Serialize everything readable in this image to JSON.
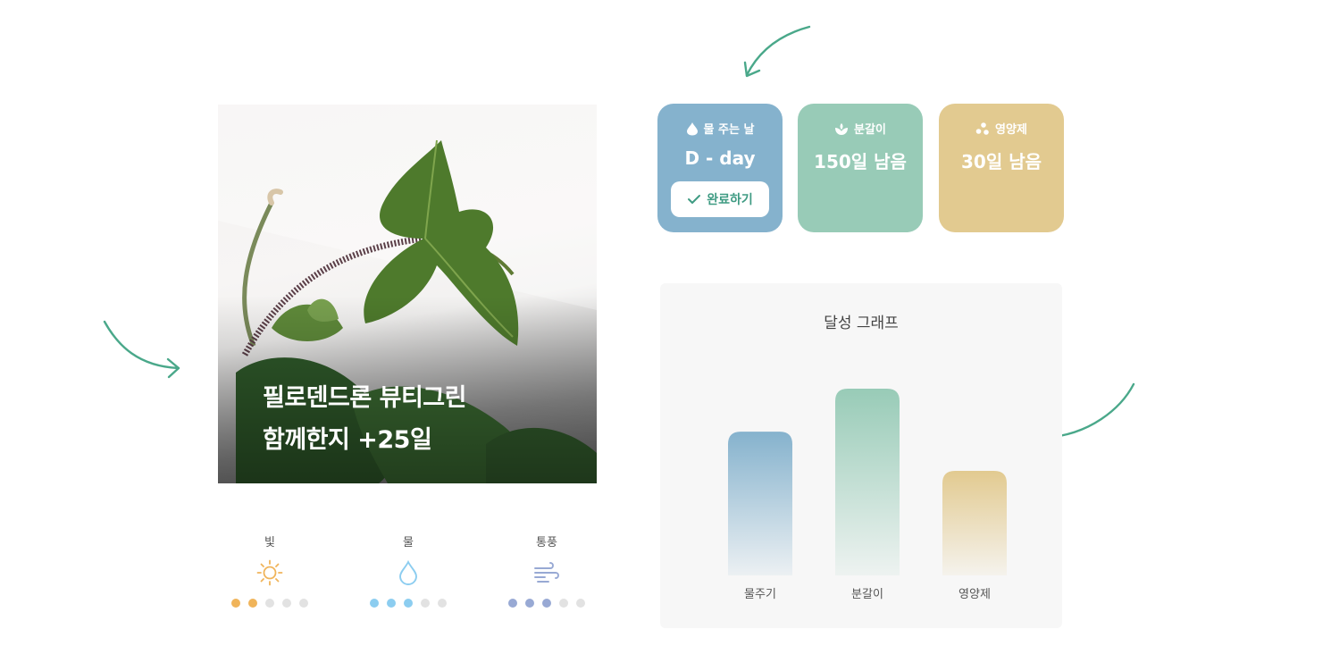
{
  "plant": {
    "name": "필로덴드론 뷰티그린",
    "together": "함께한지 +25일"
  },
  "conditions": [
    {
      "label": "빛",
      "icon": "sun-icon",
      "level": 2,
      "max": 5,
      "color": "#f0b45a"
    },
    {
      "label": "물",
      "icon": "water-drop-icon",
      "level": 3,
      "max": 5,
      "color": "#8ccdf0"
    },
    {
      "label": "통풍",
      "icon": "wind-icon",
      "level": 3,
      "max": 5,
      "color": "#98a9d4"
    }
  ],
  "status_cards": [
    {
      "title": "물 주는 날",
      "icon": "water-drop-icon",
      "value": "D - day",
      "color": "#85b2cd",
      "action": "완료하기"
    },
    {
      "title": "분갈이",
      "icon": "plant-sprout-icon",
      "value": "150일 남음",
      "color": "#98cbb7"
    },
    {
      "title": "영양제",
      "icon": "nutrient-dots-icon",
      "value": "30일 남음",
      "color": "#e2ca90"
    }
  ],
  "chart_data": {
    "type": "bar",
    "title": "달성 그래프",
    "categories": [
      "물주기",
      "분갈이",
      "영양제"
    ],
    "values": [
      0.77,
      1.0,
      0.56
    ],
    "colors": [
      "#85b2cd",
      "#98cbb7",
      "#e2ca90"
    ],
    "ylim": [
      0,
      1
    ],
    "grid": false
  }
}
